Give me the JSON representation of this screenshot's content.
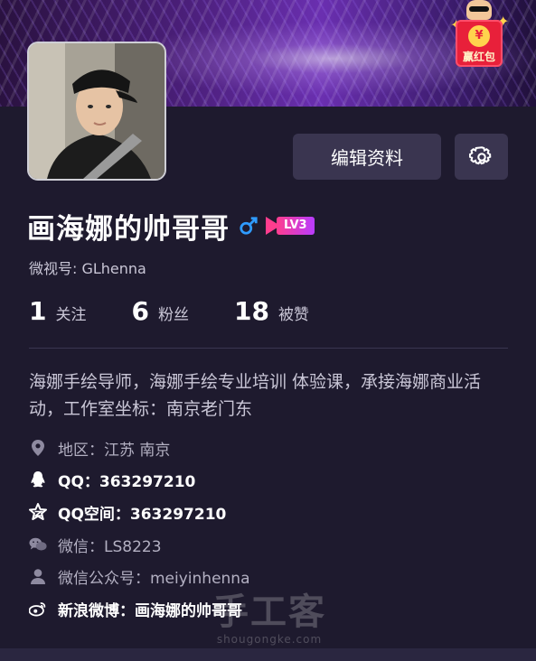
{
  "header": {
    "red_packet_label": "赢红包",
    "red_packet_coin": "¥"
  },
  "profile": {
    "edit_button": "编辑资料",
    "name": "画海娜的帅哥哥",
    "level": "LV3",
    "wechat_id": "微视号: GLhenna"
  },
  "stats": [
    {
      "num": "1",
      "label": "关注"
    },
    {
      "num": "6",
      "label": "粉丝"
    },
    {
      "num": "18",
      "label": "被赞"
    }
  ],
  "bio": "海娜手绘导师，海娜手绘专业培训 体验课，承接海娜商业活动，工作室坐标：南京老门东",
  "info": {
    "region": "地区：江苏 南京",
    "qq": "QQ：363297210",
    "qzone": "QQ空间：363297210",
    "wechat": "微信：LS8223",
    "official_account": "微信公众号：meiyinhenna",
    "weibo": "新浪微博：画海娜的帅哥哥"
  },
  "watermark": {
    "big": "手工客",
    "small": "shougongke.com"
  },
  "colors": {
    "background": "#1e1a2e",
    "button": "#3a3550",
    "gender_icon": "#2f9bff",
    "level_badge": "#ff3d8e"
  }
}
